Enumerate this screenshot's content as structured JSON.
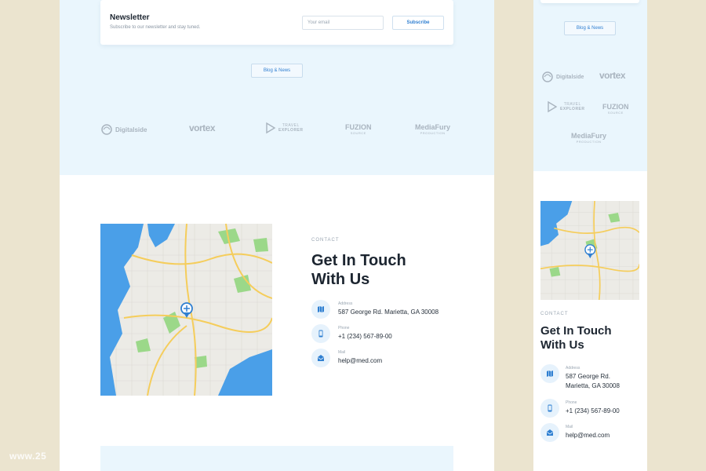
{
  "newsletter": {
    "title": "Newsletter",
    "subtitle": "Subscribe to our newsletter and stay tuned.",
    "email_placeholder": "Your email",
    "subscribe_label": "Subscribe"
  },
  "blog_news_label": "Blog & News",
  "partners": {
    "digitalside": "Digitalside",
    "vortex": "vortex",
    "travel_explorer_1": "TRAVEL",
    "travel_explorer_2": "EXPLORER",
    "fuzion": "FUZION",
    "fuzion_sub": "SOURCE",
    "mediafury": "MediaFury",
    "mediafury_sub": "PRODUCTION"
  },
  "contact": {
    "label": "CONTACT",
    "title_line1": "Get In Touch",
    "title_line2": "With Us",
    "address_caption": "Address",
    "address_value": "587 George Rd. Marietta, GA 30008",
    "address_line1": "587 George Rd.",
    "address_line2": "Marietta, GA 30008",
    "phone_caption": "Phone",
    "phone_value": "+1 (234) 567-89-00",
    "mail_caption": "Mail",
    "mail_value": "help@med.com"
  },
  "watermark": "www.25",
  "colors": {
    "accent": "#2f7fd1",
    "light_blue_bg": "#eaf6fd",
    "page_bg": "#ebe4cf",
    "map_water": "#4a9fe8",
    "map_park": "#9bd889",
    "map_road": "#f5cd5b"
  },
  "icons": {
    "address": "map-icon",
    "phone": "phone-icon",
    "mail": "mail-icon",
    "map_pin": "map-pin-icon"
  }
}
